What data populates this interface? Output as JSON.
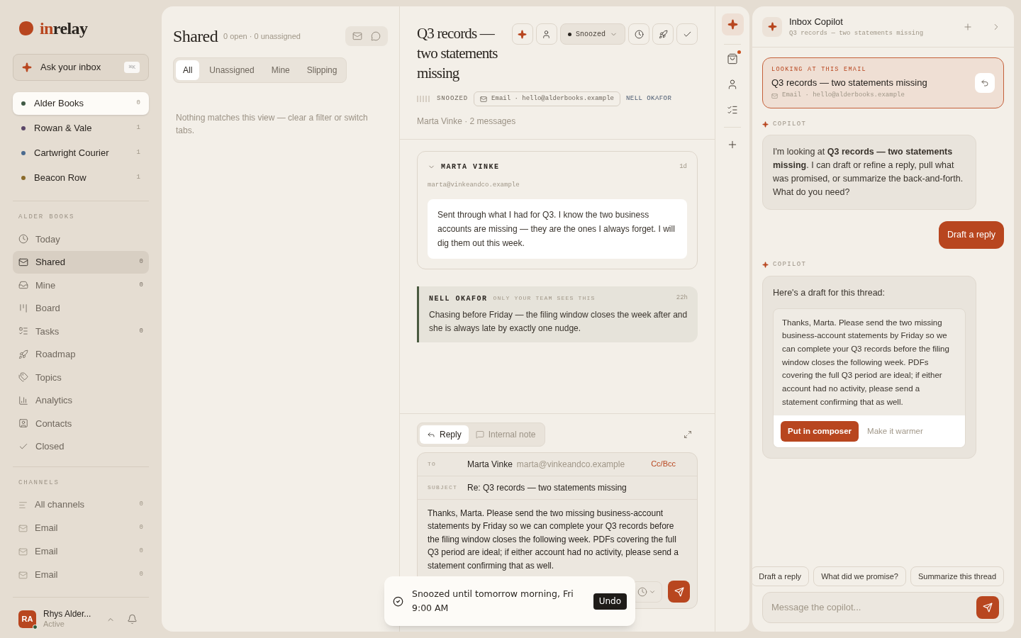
{
  "sidebar": {
    "logo": {
      "accent": "in",
      "rest": "relay"
    },
    "ask": {
      "label": "Ask your inbox",
      "shortcut": "⌘K"
    },
    "workspaces": [
      {
        "name": "Alder Books",
        "count": "0",
        "color": "#3f5a45",
        "selected": true
      },
      {
        "name": "Rowan & Vale",
        "count": "1",
        "color": "#5a4668",
        "selected": false
      },
      {
        "name": "Cartwright Courier",
        "count": "1",
        "color": "#4a6a8e",
        "selected": false
      },
      {
        "name": "Beacon Row",
        "count": "1",
        "color": "#8a6a2a",
        "selected": false
      }
    ],
    "section_label": "ALDER BOOKS",
    "nav": [
      {
        "label": "Today",
        "selected": false
      },
      {
        "label": "Shared",
        "count": "0",
        "selected": true
      },
      {
        "label": "Mine",
        "count": "0",
        "selected": false
      },
      {
        "label": "Board",
        "selected": false
      },
      {
        "label": "Tasks",
        "count": "0",
        "selected": false
      },
      {
        "label": "Roadmap",
        "selected": false
      },
      {
        "label": "Topics",
        "selected": false
      },
      {
        "label": "Analytics",
        "selected": false
      },
      {
        "label": "Contacts",
        "selected": false
      },
      {
        "label": "Closed",
        "selected": false
      }
    ],
    "channels_label": "CHANNELS",
    "channels": [
      {
        "kind": "all",
        "label": "All channels",
        "count": "0"
      },
      {
        "kind": "email",
        "label": "Email",
        "count": "0"
      },
      {
        "kind": "email",
        "label": "Email",
        "count": "0"
      },
      {
        "kind": "email",
        "label": "Email",
        "count": "0"
      }
    ],
    "user": {
      "initials": "RA",
      "name": "Rhys Alder...",
      "status": "Active",
      "online": true
    }
  },
  "list": {
    "title": "Shared",
    "summary": "0 open · 0 unassigned",
    "tabs": [
      {
        "label": "All",
        "selected": true
      },
      {
        "label": "Unassigned",
        "selected": false
      },
      {
        "label": "Mine",
        "selected": false
      },
      {
        "label": "Slipping",
        "selected": false
      }
    ],
    "empty": "Nothing matches this view — clear a filter or switch tabs."
  },
  "thread": {
    "title": "Q3 records — two statements missing",
    "status": "Snoozed",
    "status_label": "SNOOZED",
    "channel": "Email · hello@alderbooks.example",
    "assignee": "NELL OKAFOR",
    "summary": "Marta Vinke · 2 messages",
    "messages": [
      {
        "kind": "email",
        "sender": "MARTA VINKE",
        "time": "1d",
        "email": "marta@vinkeandco.example",
        "expanded": true,
        "body": "Sent through what I had for Q3. I know the two business accounts are missing — they are the ones I always forget. I will dig them out this week."
      },
      {
        "kind": "note",
        "sender": "NELL OKAFOR",
        "tag": "ONLY YOUR TEAM SEES THIS",
        "time": "22h",
        "body": "Chasing before Friday — the filing window closes the week after and she is always late by exactly one nudge."
      }
    ]
  },
  "composer": {
    "modes": [
      {
        "label": "Reply",
        "selected": true
      },
      {
        "label": "Internal note",
        "selected": false
      }
    ],
    "to_label": "TO",
    "to_name": "Marta Vinke",
    "to_email": "marta@vinkeandco.example",
    "cc": "Cc/Bcc",
    "subject_label": "SUBJECT",
    "subject": "Re: Q3 records — two statements missing",
    "body": "Thanks, Marta. Please send the two missing business-account statements by Friday so we can complete your Q3 records before the filing window closes the following week. PDFs covering the full Q3 period are ideal; if either account had no activity, please send a statement confirming that as well."
  },
  "toast": {
    "text": "Snoozed until tomorrow morning, Fri 9:00 AM",
    "action": "Undo"
  },
  "rail": {
    "alert": true
  },
  "copilot": {
    "title": "Inbox Copilot",
    "subtitle": "Q3 records — two statements missing",
    "context": {
      "label": "LOOKING AT THIS EMAIL",
      "title": "Q3 records — two statements missing",
      "meta": "Email · hello@alderbooks.example"
    },
    "messages": [
      {
        "kind": "assistant",
        "author": "COPILOT",
        "text": "I'm looking at **Q3 records — two statements missing**. I can draft or refine a reply, pull what was promised, or summarize the back-and-forth. What do you need?"
      },
      {
        "kind": "user",
        "text": "Draft a reply"
      },
      {
        "kind": "assistant",
        "author": "COPILOT",
        "text": "Here's a draft for this thread:",
        "draft": {
          "body": "Thanks, Marta. Please send the two missing business-account statements by Friday so we can complete your Q3 records before the filing window closes the following week. PDFs covering the full Q3 period are ideal; if either account had no activity, please send a statement confirming that as well.",
          "primary": "Put in composer",
          "secondary": "Make it warmer"
        }
      }
    ],
    "suggestions": [
      "Draft a reply",
      "What did we promise?",
      "Summarize this thread"
    ],
    "placeholder": "Message the copilot..."
  }
}
